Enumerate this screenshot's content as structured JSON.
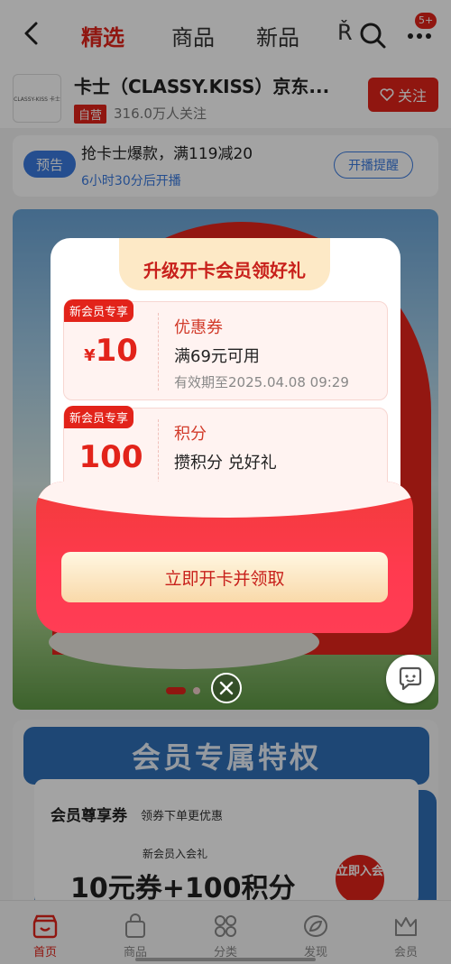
{
  "topnav": {
    "tabs": [
      {
        "label": "精选",
        "active": true
      },
      {
        "label": "商品",
        "active": false
      },
      {
        "label": "新品",
        "active": false
      },
      {
        "label": "Ř",
        "active": false
      }
    ],
    "notification_count": "5+"
  },
  "shop": {
    "logo_text": "CLASSY-KISS 卡士",
    "name": "卡士（CLASSY.KISS）京东...",
    "self_operated_tag": "自营",
    "followers": "316.0万人关注",
    "follow_label": "关注"
  },
  "preview": {
    "tag": "预告",
    "title": "抢卡士爆款，满119减20",
    "time": "6小时30分后开播",
    "remind_label": "开播提醒"
  },
  "popup": {
    "title": "升级开卡会员领好礼",
    "coupons": [
      {
        "tag": "新会员专享",
        "currency": "¥",
        "amount": "10",
        "kind": "优惠券",
        "condition": "满69元可用",
        "validity": "有效期至2025.04.08 09:29"
      },
      {
        "tag": "新会员专享",
        "currency": "",
        "amount": "100",
        "kind": "积分",
        "condition": "攒积分 兑好礼",
        "validity": ""
      }
    ],
    "claim_label": "立即开卡并领取"
  },
  "member": {
    "header": "会员专属特权",
    "card_title": "会员尊享券",
    "card_subtitle": "领券下单更优惠",
    "gift_label": "新会员入会礼",
    "gift_big": "10元券+100积分",
    "claim_btn": "立即入会"
  },
  "tabbar": {
    "items": [
      {
        "label": "首页",
        "icon": "store-icon",
        "active": true
      },
      {
        "label": "商品",
        "icon": "bag-icon",
        "active": false
      },
      {
        "label": "分类",
        "icon": "grid-icon",
        "active": false
      },
      {
        "label": "发现",
        "icon": "leaf-icon",
        "active": false
      },
      {
        "label": "会员",
        "icon": "crown-icon",
        "active": false
      }
    ]
  },
  "colors": {
    "accent": "#e2231a",
    "blue": "#3a7be0",
    "member_blue": "#2f6fb8"
  }
}
